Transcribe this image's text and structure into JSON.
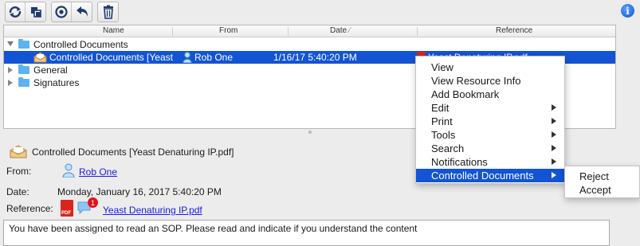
{
  "toolbar": {
    "groups": [
      [
        "refresh-icon",
        "copy-icon"
      ],
      [
        "eye-icon",
        "back-arrow-icon"
      ],
      [
        "trash-icon"
      ]
    ]
  },
  "info_icon_text": "i",
  "table": {
    "columns": [
      "Name",
      "From",
      "Date",
      "Reference"
    ],
    "date_sort_indicator": "⁄",
    "rows": [
      {
        "name": "Controlled Documents",
        "expanded": true,
        "type": "folder"
      },
      {
        "name": "Controlled Documents [Yeast",
        "from": "Rob One",
        "date": "1/16/17 5:40:20 PM",
        "reference": "Yeast Denaturing IP.pdf",
        "type": "message",
        "selected": true
      },
      {
        "name": "General",
        "expanded": false,
        "type": "folder"
      },
      {
        "name": "Signatures",
        "expanded": false,
        "type": "folder"
      }
    ]
  },
  "detail": {
    "title": "Controlled Documents [Yeast Denaturing IP.pdf]",
    "from_label": "From:",
    "from_value": "Rob One",
    "date_label": "Date:",
    "date_value": "Monday, January 16, 2017 5:40:20 PM",
    "reference_label": "Reference:",
    "pdf_badge": "PDF",
    "comment_count": "1",
    "reference_value": "Yeast Denaturing IP.pdf",
    "message": "You have been assigned to read an SOP.  Please read and indicate if you understand the content"
  },
  "context_menu": {
    "items": [
      {
        "label": "View",
        "submenu": false
      },
      {
        "label": "View Resource Info",
        "submenu": false
      },
      {
        "label": "Add Bookmark",
        "submenu": false
      },
      {
        "label": "Edit",
        "submenu": true
      },
      {
        "label": "Print",
        "submenu": true
      },
      {
        "label": "Tools",
        "submenu": true
      },
      {
        "label": "Search",
        "submenu": true
      },
      {
        "label": "Notifications",
        "submenu": true
      },
      {
        "label": "Controlled Documents",
        "submenu": true,
        "highlighted": true
      }
    ],
    "submenu_items": [
      "Reject",
      "Accept"
    ]
  },
  "colors": {
    "selection": "#1354d4",
    "folder": "#5cb3f0",
    "link": "#1a1aee"
  }
}
